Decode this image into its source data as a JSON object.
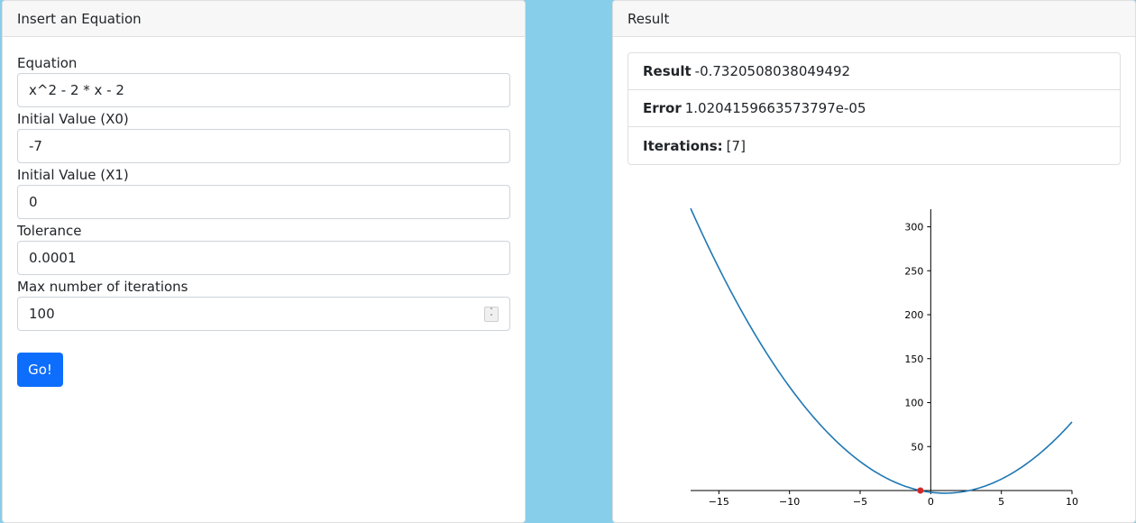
{
  "left_panel": {
    "header": "Insert an Equation",
    "fields": [
      {
        "label": "Equation",
        "value": "x^2 - 2 * x - 2"
      },
      {
        "label": "Initial Value (X0)",
        "value": "-7"
      },
      {
        "label": "Initial Value (X1)",
        "value": "0"
      },
      {
        "label": "Tolerance",
        "value": "0.0001"
      },
      {
        "label": "Max number of iterations",
        "value": "100"
      }
    ],
    "go_button": "Go!"
  },
  "right_panel": {
    "header": "Result",
    "results": [
      {
        "label": "Result",
        "value": "-0.7320508038049492"
      },
      {
        "label": "Error",
        "value": "1.0204159663573797e-05"
      },
      {
        "label": "Iterations:",
        "value": "[7]"
      }
    ]
  },
  "chart_data": {
    "type": "line",
    "function": "x^2 - 2*x - 2",
    "xlim": [
      -17,
      10
    ],
    "ylim": [
      0,
      320
    ],
    "x_ticks": [
      -15,
      -10,
      -5,
      0,
      5,
      10
    ],
    "x_tick_labels": [
      "−15",
      "−10",
      "−5",
      "0",
      "5",
      "10"
    ],
    "y_ticks": [
      50,
      100,
      150,
      200,
      250,
      300
    ],
    "y_tick_labels": [
      "50",
      "100",
      "150",
      "200",
      "250",
      "300"
    ],
    "series_color": "#1f77b4",
    "root_point": {
      "x": -0.7320508038049492,
      "y": 0
    },
    "root_color": "#d62728",
    "grid": false,
    "title": "",
    "xlabel": "",
    "ylabel": ""
  }
}
